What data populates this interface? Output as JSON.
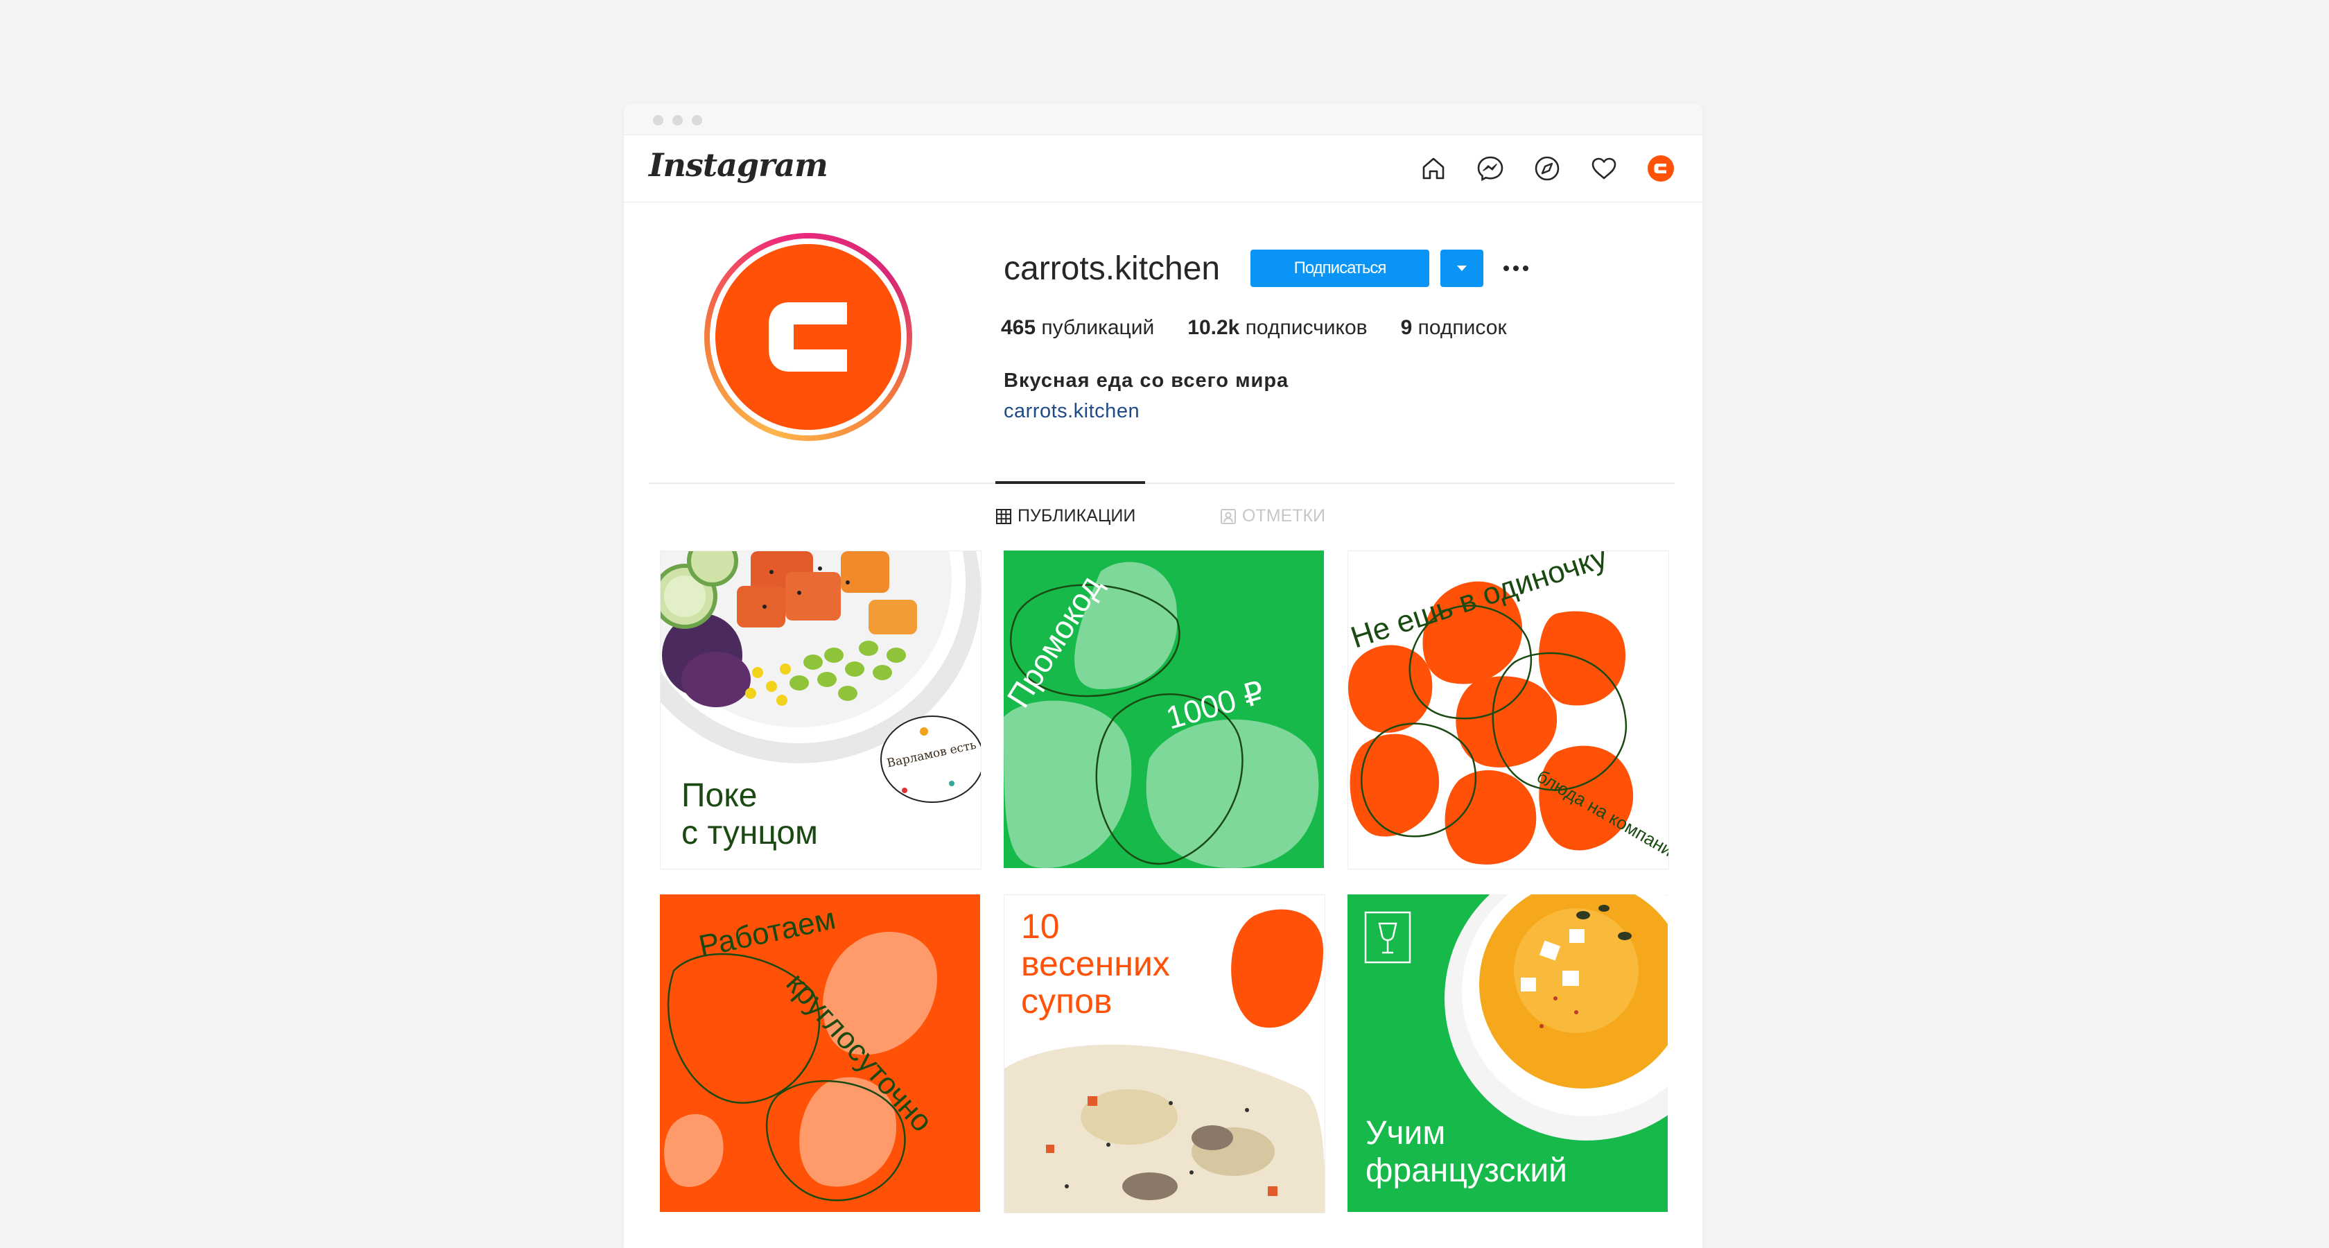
{
  "brand": "Instagram",
  "nav": {
    "icons": [
      "home-icon",
      "messenger-icon",
      "explore-icon",
      "heart-icon",
      "profile-avatar-icon"
    ]
  },
  "profile": {
    "username": "carrots.kitchen",
    "follow_label": "Подписаться",
    "stats": [
      {
        "value": "465",
        "label": "публикаций"
      },
      {
        "value": "10.2k",
        "label": "подписчиков"
      },
      {
        "value": "9",
        "label": "подписок"
      }
    ],
    "bio": "Вкусная еда со всего мира",
    "link": "carrots.kitchen"
  },
  "tabs": [
    {
      "label": "Публикации",
      "active": true
    },
    {
      "label": "Отметки",
      "active": false
    }
  ],
  "posts": [
    {
      "title_line1": "Поке",
      "title_line2": "с тунцом",
      "sticker": "Варламов есть"
    },
    {
      "line1": "Промокод",
      "line2": "1000 ₽"
    },
    {
      "line1": "Не ешь в одиночку",
      "line2": "блюда на компанию"
    },
    {
      "line1": "Работаем",
      "line2": "круглосуточно"
    },
    {
      "line1": "10",
      "line2": "весенних",
      "line3": "супов"
    },
    {
      "line1": "Учим",
      "line2": "французский"
    }
  ],
  "colors": {
    "orange": "#ff5107",
    "green": "#16b94a",
    "dark_green": "#1a4a12",
    "blue": "#0a95f6"
  }
}
